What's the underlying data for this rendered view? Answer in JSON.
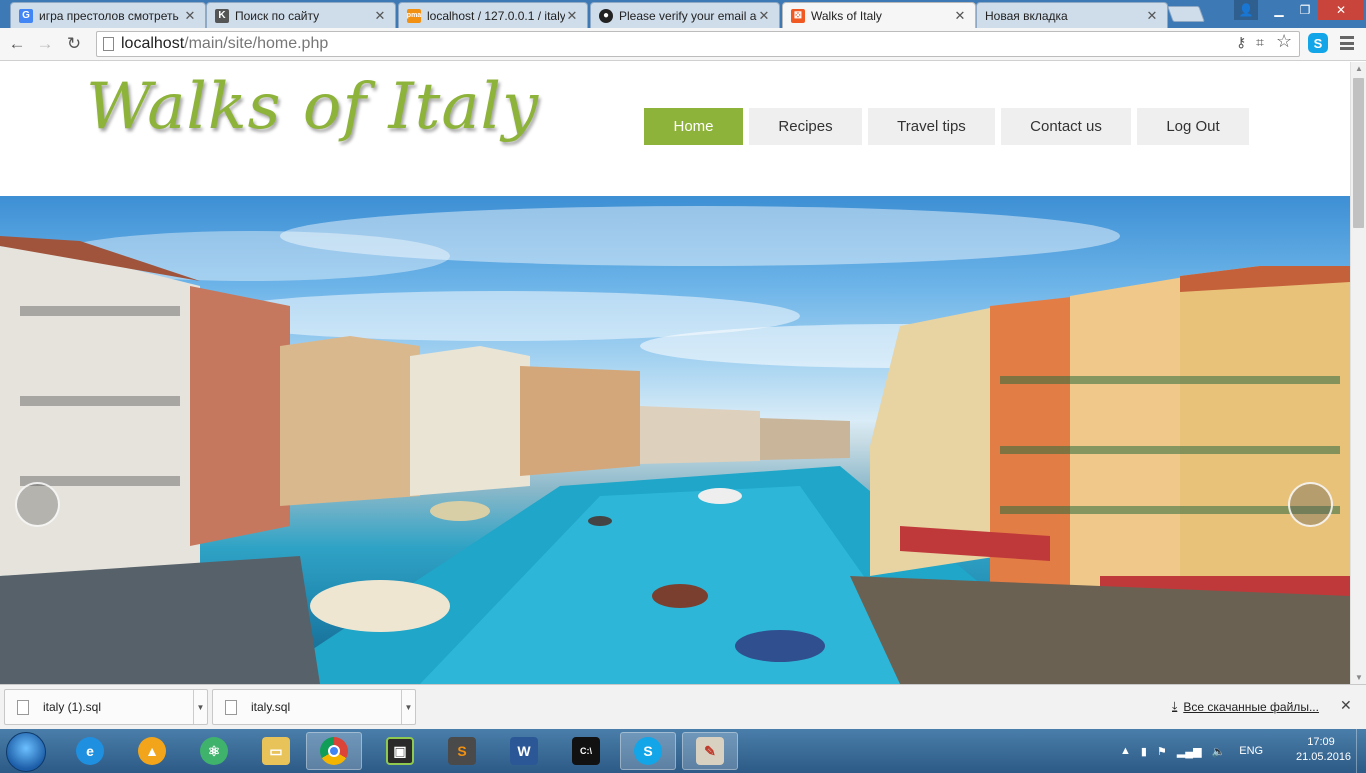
{
  "tabs": [
    {
      "title": "игра престолов смотреть",
      "favicon": "google-icon",
      "color": "#4285f4",
      "glyph": "G"
    },
    {
      "title": "Поиск по сайту",
      "favicon": "k-icon",
      "color": "#555555",
      "glyph": "K"
    },
    {
      "title": "localhost / 127.0.0.1 / italy",
      "favicon": "phpmyadmin-icon",
      "color": "#f29111",
      "glyph": "pma"
    },
    {
      "title": "Please verify your email ad",
      "favicon": "github-icon",
      "color": "#222222",
      "glyph": "●"
    },
    {
      "title": "Walks of Italy",
      "favicon": "xampp-icon",
      "color": "#f05a22",
      "glyph": "⊠"
    },
    {
      "title": "Новая вкладка",
      "favicon": "",
      "color": "",
      "glyph": ""
    }
  ],
  "toolbar": {
    "url_host": "localhost",
    "url_path": "/main/site/home.php"
  },
  "site": {
    "logo": "Walks of Italy",
    "nav": [
      "Home",
      "Recipes",
      "Travel tips",
      "Contact us",
      "Log Out"
    ],
    "active_nav": "Home",
    "accent": "#8db33a"
  },
  "downloads": {
    "items": [
      "italy (1).sql",
      "italy.sql"
    ],
    "show_all": "Все скачанные файлы..."
  },
  "taskbar": {
    "lang": "ENG",
    "time": "17:09",
    "date": "21.05.2016"
  }
}
